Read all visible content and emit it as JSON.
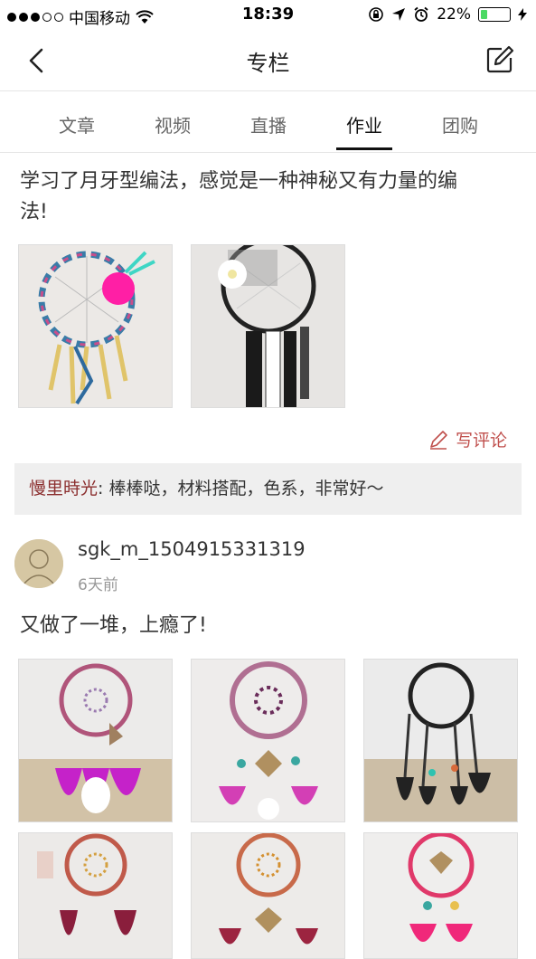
{
  "status": {
    "carrier": "中国移动",
    "time": "18:39",
    "battery": "22%",
    "battery_level": 0.22
  },
  "nav": {
    "title": "专栏"
  },
  "tabs": [
    {
      "label": "文章"
    },
    {
      "label": "视频"
    },
    {
      "label": "直播"
    },
    {
      "label": "作业",
      "active": true
    },
    {
      "label": "团购"
    }
  ],
  "post1": {
    "text_line1": "学习了月牙型编法，感觉是一种神秘又有力量的编",
    "text_line2": "法!",
    "comment_button": "写评论",
    "comment": {
      "user": "慢里時光",
      "separator": ": ",
      "text": "棒棒哒，材料搭配，色系，非常好～"
    }
  },
  "post2": {
    "username": "sgk_m_1504915331319",
    "time": "6天前",
    "text": "又做了一堆，上瘾了!"
  },
  "colors": {
    "accent": "#c0504d",
    "comment_user": "#8b2e2e",
    "battery_green": "#4cd964"
  }
}
